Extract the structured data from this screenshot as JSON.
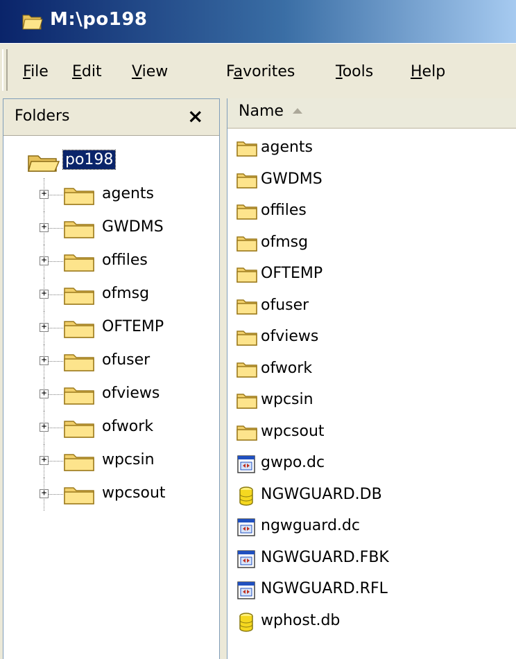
{
  "window": {
    "title": "M:\\po198"
  },
  "menu": {
    "file": [
      "",
      "F",
      "ile"
    ],
    "edit": [
      "",
      "E",
      "dit"
    ],
    "view": [
      "",
      "V",
      "iew"
    ],
    "favorites": [
      "F",
      "a",
      "vorites"
    ],
    "tools": [
      "",
      "T",
      "ools"
    ],
    "help": [
      "",
      "H",
      "elp"
    ]
  },
  "folders_pane": {
    "title": "Folders",
    "close": "×",
    "root": "po198",
    "items": [
      "agents",
      "GWDMS",
      "offiles",
      "ofmsg",
      "OFTEMP",
      "ofuser",
      "ofviews",
      "ofwork",
      "wpcsin",
      "wpcsout"
    ],
    "expander": "+"
  },
  "files_pane": {
    "column_name": "Name",
    "items": [
      {
        "name": "agents",
        "icon": "folder-icon"
      },
      {
        "name": "GWDMS",
        "icon": "folder-icon"
      },
      {
        "name": "offiles",
        "icon": "folder-icon"
      },
      {
        "name": "ofmsg",
        "icon": "folder-icon"
      },
      {
        "name": "OFTEMP",
        "icon": "folder-icon"
      },
      {
        "name": "ofuser",
        "icon": "folder-icon"
      },
      {
        "name": "ofviews",
        "icon": "folder-icon"
      },
      {
        "name": "ofwork",
        "icon": "folder-icon"
      },
      {
        "name": "wpcsin",
        "icon": "folder-icon"
      },
      {
        "name": "wpcsout",
        "icon": "folder-icon"
      },
      {
        "name": "gwpo.dc",
        "icon": "file-icon"
      },
      {
        "name": "NGWGUARD.DB",
        "icon": "database-icon"
      },
      {
        "name": "ngwguard.dc",
        "icon": "file-icon"
      },
      {
        "name": "NGWGUARD.FBK",
        "icon": "file-icon"
      },
      {
        "name": "NGWGUARD.RFL",
        "icon": "file-icon"
      },
      {
        "name": "wphost.db",
        "icon": "database-icon"
      }
    ]
  }
}
